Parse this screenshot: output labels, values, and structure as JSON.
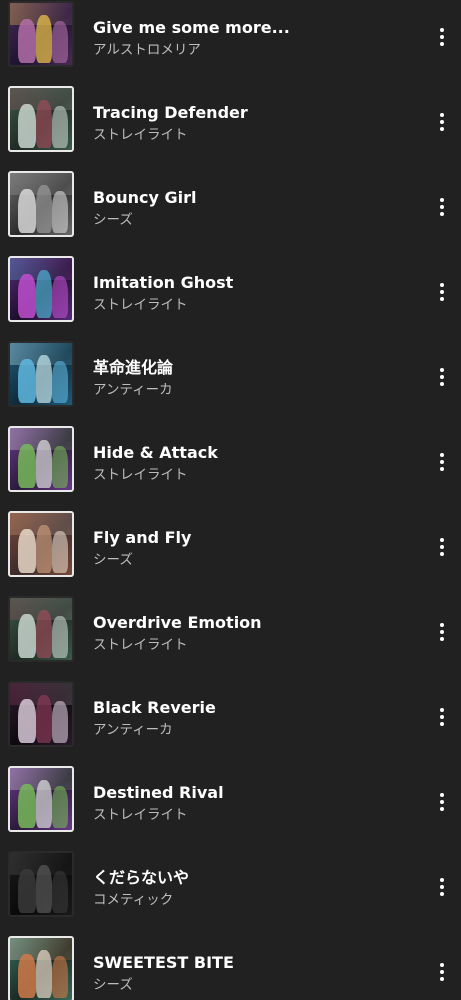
{
  "songs": [
    {
      "title": "Give me some more...",
      "artist": "アルストロメリア",
      "art": [
        "#4a2a55",
        "#b36fa8",
        "#1d1330",
        "#f2c94c"
      ],
      "dark": true
    },
    {
      "title": "Tracing Defender",
      "artist": "ストレイライト",
      "art": [
        "#3c5a4a",
        "#c9d6cf",
        "#1e2a24",
        "#9a4d5a"
      ],
      "dark": false
    },
    {
      "title": "Bouncy Girl",
      "artist": "シーズ",
      "art": [
        "#6a6a6a",
        "#d8d8d8",
        "#2a2a2a",
        "#9b9b9b"
      ],
      "dark": false
    },
    {
      "title": "Imitation Ghost",
      "artist": "ストレイライト",
      "art": [
        "#5a2a7a",
        "#c04fd0",
        "#1a0f2a",
        "#4fb0d0"
      ],
      "dark": false
    },
    {
      "title": "革命進化論",
      "artist": "アンティーカ",
      "art": [
        "#1f5a7a",
        "#5fb8e0",
        "#0f2a3a",
        "#c8e8f0"
      ],
      "dark": true
    },
    {
      "title": "Hide & Attack",
      "artist": "ストレイライト",
      "art": [
        "#6a3a8a",
        "#78b85a",
        "#2a1a3a",
        "#e0e0e0"
      ],
      "dark": false
    },
    {
      "title": "Fly and Fly",
      "artist": "シーズ",
      "art": [
        "#7a4a3a",
        "#e8d8c8",
        "#3a2a2a",
        "#c89a7a"
      ],
      "dark": false
    },
    {
      "title": "Overdrive Emotion",
      "artist": "ストレイライト",
      "art": [
        "#3c5a4a",
        "#c9d6cf",
        "#1e2a24",
        "#9a4d5a"
      ],
      "dark": true
    },
    {
      "title": "Black Reverie",
      "artist": "アンティーカ",
      "art": [
        "#2a1a2a",
        "#d8c8d8",
        "#0f0a0f",
        "#8a3a5a"
      ],
      "dark": true
    },
    {
      "title": "Destined Rival",
      "artist": "ストレイライト",
      "art": [
        "#6a3a8a",
        "#78b85a",
        "#2a1a3a",
        "#e0e0e0"
      ],
      "dark": false
    },
    {
      "title": "くだらないや",
      "artist": "コメティック",
      "art": [
        "#1a1a1a",
        "#3a3a3a",
        "#0a0a0a",
        "#5a5a5a"
      ],
      "dark": true
    },
    {
      "title": "SWEETEST BITE",
      "artist": "シーズ",
      "art": [
        "#3a6a5a",
        "#d07a4a",
        "#1a2a24",
        "#e8d8c8"
      ],
      "dark": false
    }
  ],
  "menu_icon": "more-vertical-icon"
}
